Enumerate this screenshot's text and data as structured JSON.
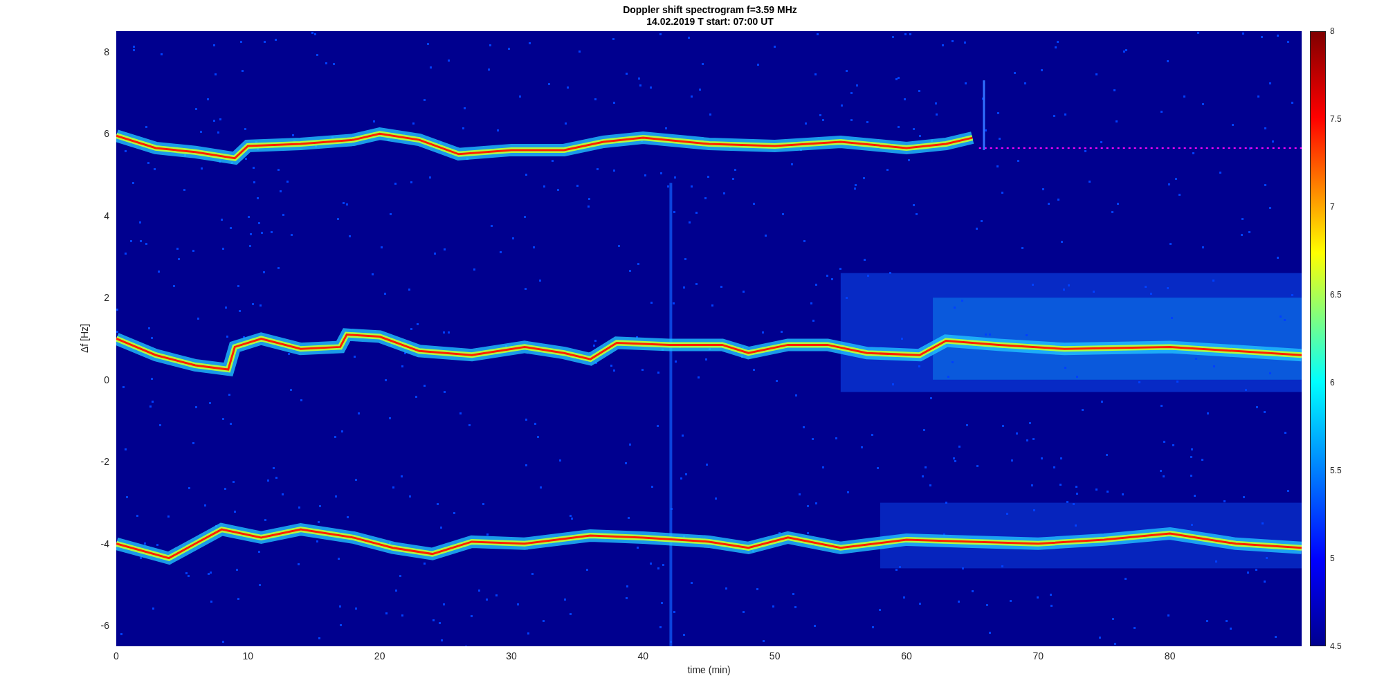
{
  "figure": {
    "title_lines": [
      "Doppler shift spectrogram f=3.59 MHz",
      "14.02.2019    T start: 07:00 UT"
    ],
    "x_axis": {
      "label": "time (min)",
      "ticks": [
        "0",
        "10",
        "20",
        "30",
        "40",
        "50",
        "60",
        "70",
        "80"
      ]
    },
    "y_axis": {
      "label": "Δf [Hz]",
      "ticks": [
        "8",
        "6",
        "4",
        "2",
        "0",
        "-2",
        "-4",
        "-6"
      ]
    },
    "colorbar": {
      "ticks": [
        "8",
        "7.5",
        "7",
        "6.5",
        "6",
        "5.5",
        "5",
        "4.5"
      ]
    }
  }
}
